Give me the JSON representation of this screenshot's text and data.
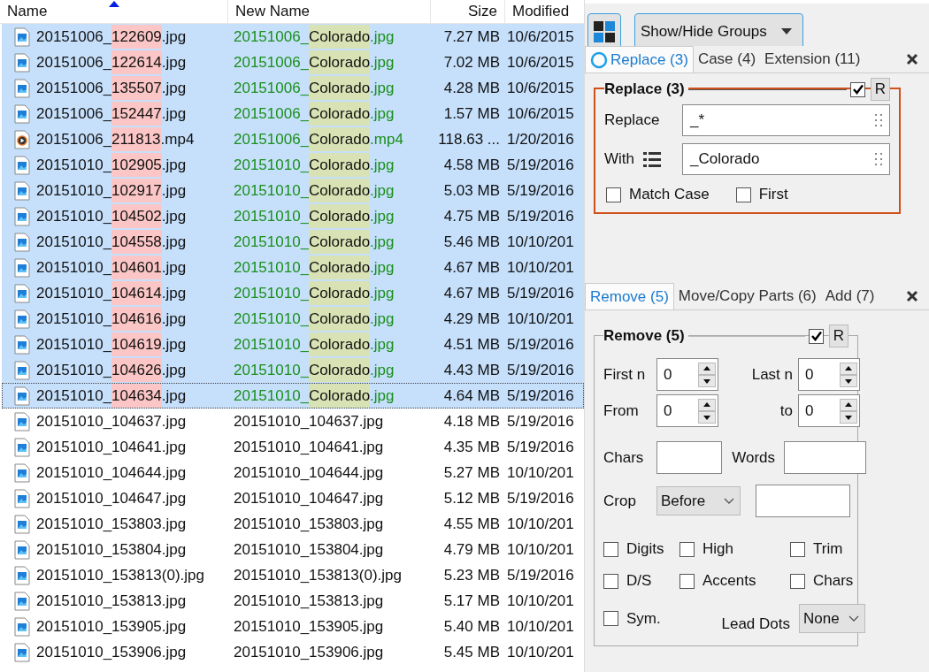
{
  "table": {
    "columns": [
      {
        "label": "Name",
        "sorted": true
      },
      {
        "label": "New Name",
        "sorted": false
      },
      {
        "label": "Size",
        "sorted": false
      },
      {
        "label": "Modified",
        "sorted": false
      }
    ],
    "rows": [
      {
        "kind": "image",
        "selected": true,
        "focused": false,
        "renamed": true,
        "name": [
          "20151006_",
          "122609",
          ".jpg"
        ],
        "new_name": [
          "20151006_",
          "Colorado",
          ".jpg"
        ],
        "size": "7.27 MB",
        "modified": "10/6/2015"
      },
      {
        "kind": "image",
        "selected": true,
        "focused": false,
        "renamed": true,
        "name": [
          "20151006_",
          "122614",
          ".jpg"
        ],
        "new_name": [
          "20151006_",
          "Colorado",
          ".jpg"
        ],
        "size": "7.02 MB",
        "modified": "10/6/2015"
      },
      {
        "kind": "image",
        "selected": true,
        "focused": false,
        "renamed": true,
        "name": [
          "20151006_",
          "135507",
          ".jpg"
        ],
        "new_name": [
          "20151006_",
          "Colorado",
          ".jpg"
        ],
        "size": "4.28 MB",
        "modified": "10/6/2015"
      },
      {
        "kind": "image",
        "selected": true,
        "focused": false,
        "renamed": true,
        "name": [
          "20151006_",
          "152447",
          ".jpg"
        ],
        "new_name": [
          "20151006_",
          "Colorado",
          ".jpg"
        ],
        "size": "1.57 MB",
        "modified": "10/6/2015"
      },
      {
        "kind": "video",
        "selected": true,
        "focused": false,
        "renamed": true,
        "name": [
          "20151006_",
          "211813",
          ".mp4"
        ],
        "new_name": [
          "20151006_",
          "Colorado",
          ".mp4"
        ],
        "size": "118.63 ...",
        "modified": "1/20/2016"
      },
      {
        "kind": "image",
        "selected": true,
        "focused": false,
        "renamed": true,
        "name": [
          "20151010_",
          "102905",
          ".jpg"
        ],
        "new_name": [
          "20151010_",
          "Colorado",
          ".jpg"
        ],
        "size": "4.58 MB",
        "modified": "5/19/2016"
      },
      {
        "kind": "image",
        "selected": true,
        "focused": false,
        "renamed": true,
        "name": [
          "20151010_",
          "102917",
          ".jpg"
        ],
        "new_name": [
          "20151010_",
          "Colorado",
          ".jpg"
        ],
        "size": "5.03 MB",
        "modified": "5/19/2016"
      },
      {
        "kind": "image",
        "selected": true,
        "focused": false,
        "renamed": true,
        "name": [
          "20151010_",
          "104502",
          ".jpg"
        ],
        "new_name": [
          "20151010_",
          "Colorado",
          ".jpg"
        ],
        "size": "4.75 MB",
        "modified": "5/19/2016"
      },
      {
        "kind": "image",
        "selected": true,
        "focused": false,
        "renamed": true,
        "name": [
          "20151010_",
          "104558",
          ".jpg"
        ],
        "new_name": [
          "20151010_",
          "Colorado",
          ".jpg"
        ],
        "size": "5.46 MB",
        "modified": "10/10/201"
      },
      {
        "kind": "image",
        "selected": true,
        "focused": false,
        "renamed": true,
        "name": [
          "20151010_",
          "104601",
          ".jpg"
        ],
        "new_name": [
          "20151010_",
          "Colorado",
          ".jpg"
        ],
        "size": "4.67 MB",
        "modified": "10/10/201"
      },
      {
        "kind": "image",
        "selected": true,
        "focused": false,
        "renamed": true,
        "name": [
          "20151010_",
          "104614",
          ".jpg"
        ],
        "new_name": [
          "20151010_",
          "Colorado",
          ".jpg"
        ],
        "size": "4.67 MB",
        "modified": "5/19/2016"
      },
      {
        "kind": "image",
        "selected": true,
        "focused": false,
        "renamed": true,
        "name": [
          "20151010_",
          "104616",
          ".jpg"
        ],
        "new_name": [
          "20151010_",
          "Colorado",
          ".jpg"
        ],
        "size": "4.29 MB",
        "modified": "10/10/201"
      },
      {
        "kind": "image",
        "selected": true,
        "focused": false,
        "renamed": true,
        "name": [
          "20151010_",
          "104619",
          ".jpg"
        ],
        "new_name": [
          "20151010_",
          "Colorado",
          ".jpg"
        ],
        "size": "4.51 MB",
        "modified": "5/19/2016"
      },
      {
        "kind": "image",
        "selected": true,
        "focused": false,
        "renamed": true,
        "name": [
          "20151010_",
          "104626",
          ".jpg"
        ],
        "new_name": [
          "20151010_",
          "Colorado",
          ".jpg"
        ],
        "size": "4.43 MB",
        "modified": "5/19/2016"
      },
      {
        "kind": "image",
        "selected": true,
        "focused": true,
        "renamed": true,
        "name": [
          "20151010_",
          "104634",
          ".jpg"
        ],
        "new_name": [
          "20151010_",
          "Colorado",
          ".jpg"
        ],
        "size": "4.64 MB",
        "modified": "5/19/2016"
      },
      {
        "kind": "image",
        "selected": false,
        "focused": false,
        "renamed": false,
        "name": [
          "20151010_104637.jpg"
        ],
        "new_name": [
          "20151010_104637.jpg"
        ],
        "size": "4.18 MB",
        "modified": "5/19/2016"
      },
      {
        "kind": "image",
        "selected": false,
        "focused": false,
        "renamed": false,
        "name": [
          "20151010_104641.jpg"
        ],
        "new_name": [
          "20151010_104641.jpg"
        ],
        "size": "4.35 MB",
        "modified": "5/19/2016"
      },
      {
        "kind": "image",
        "selected": false,
        "focused": false,
        "renamed": false,
        "name": [
          "20151010_104644.jpg"
        ],
        "new_name": [
          "20151010_104644.jpg"
        ],
        "size": "5.27 MB",
        "modified": "10/10/201"
      },
      {
        "kind": "image",
        "selected": false,
        "focused": false,
        "renamed": false,
        "name": [
          "20151010_104647.jpg"
        ],
        "new_name": [
          "20151010_104647.jpg"
        ],
        "size": "5.12 MB",
        "modified": "5/19/2016"
      },
      {
        "kind": "image",
        "selected": false,
        "focused": false,
        "renamed": false,
        "name": [
          "20151010_153803.jpg"
        ],
        "new_name": [
          "20151010_153803.jpg"
        ],
        "size": "4.55 MB",
        "modified": "10/10/201"
      },
      {
        "kind": "image",
        "selected": false,
        "focused": false,
        "renamed": false,
        "name": [
          "20151010_153804.jpg"
        ],
        "new_name": [
          "20151010_153804.jpg"
        ],
        "size": "4.79 MB",
        "modified": "10/10/201"
      },
      {
        "kind": "image",
        "selected": false,
        "focused": false,
        "renamed": false,
        "name": [
          "20151010_153813(0).jpg"
        ],
        "new_name": [
          "20151010_153813(0).jpg"
        ],
        "size": "5.23 MB",
        "modified": "5/19/2016"
      },
      {
        "kind": "image",
        "selected": false,
        "focused": false,
        "renamed": false,
        "name": [
          "20151010_153813.jpg"
        ],
        "new_name": [
          "20151010_153813.jpg"
        ],
        "size": "5.17 MB",
        "modified": "10/10/201"
      },
      {
        "kind": "image",
        "selected": false,
        "focused": false,
        "renamed": false,
        "name": [
          "20151010_153905.jpg"
        ],
        "new_name": [
          "20151010_153905.jpg"
        ],
        "size": "5.40 MB",
        "modified": "10/10/201"
      },
      {
        "kind": "image",
        "selected": false,
        "focused": false,
        "renamed": false,
        "name": [
          "20151010_153906.jpg"
        ],
        "new_name": [
          "20151010_153906.jpg"
        ],
        "size": "5.45 MB",
        "modified": "10/10/201"
      }
    ]
  },
  "toolbar": {
    "groups_button": "Show/Hide Groups"
  },
  "replace_panel": {
    "tabs": [
      {
        "label": "Replace (3)",
        "selected": true
      },
      {
        "label": "Case (4)",
        "selected": false
      },
      {
        "label": "Extension (11)",
        "selected": false
      }
    ],
    "group": {
      "title": "Replace (3)",
      "enabled": true,
      "active": true,
      "reset": "R",
      "fields": [
        {
          "label": "Replace",
          "value": "_*"
        },
        {
          "label": "With",
          "value": "_Colorado"
        }
      ],
      "options": [
        {
          "label": "Match Case",
          "checked": false
        },
        {
          "label": "First",
          "checked": false
        }
      ]
    }
  },
  "remove_panel": {
    "tabs": [
      {
        "label": "Remove (5)",
        "selected": true
      },
      {
        "label": "Move/Copy Parts (6)",
        "selected": false
      },
      {
        "label": "Add (7)",
        "selected": false
      }
    ],
    "group": {
      "title": "Remove (5)",
      "enabled": true,
      "active": false,
      "reset": "R",
      "spinners": [
        {
          "label": "First n",
          "value": "0"
        },
        {
          "label": "Last n",
          "value": "0"
        },
        {
          "label": "From",
          "value": "0"
        },
        {
          "label": "to",
          "value": "0"
        }
      ],
      "text_fields": [
        {
          "label": "Chars"
        },
        {
          "label": "Words"
        }
      ],
      "crop": {
        "label": "Crop",
        "option": "Before"
      },
      "options": [
        {
          "label": "Digits",
          "checked": false
        },
        {
          "label": "High",
          "checked": false
        },
        {
          "label": "Trim",
          "checked": false
        },
        {
          "label": "D/S",
          "checked": false
        },
        {
          "label": "Accents",
          "checked": false
        },
        {
          "label": "Chars",
          "checked": false
        },
        {
          "label": "Sym.",
          "checked": false
        }
      ],
      "lead_dots": {
        "label": "Lead Dots",
        "option": "None"
      }
    }
  }
}
